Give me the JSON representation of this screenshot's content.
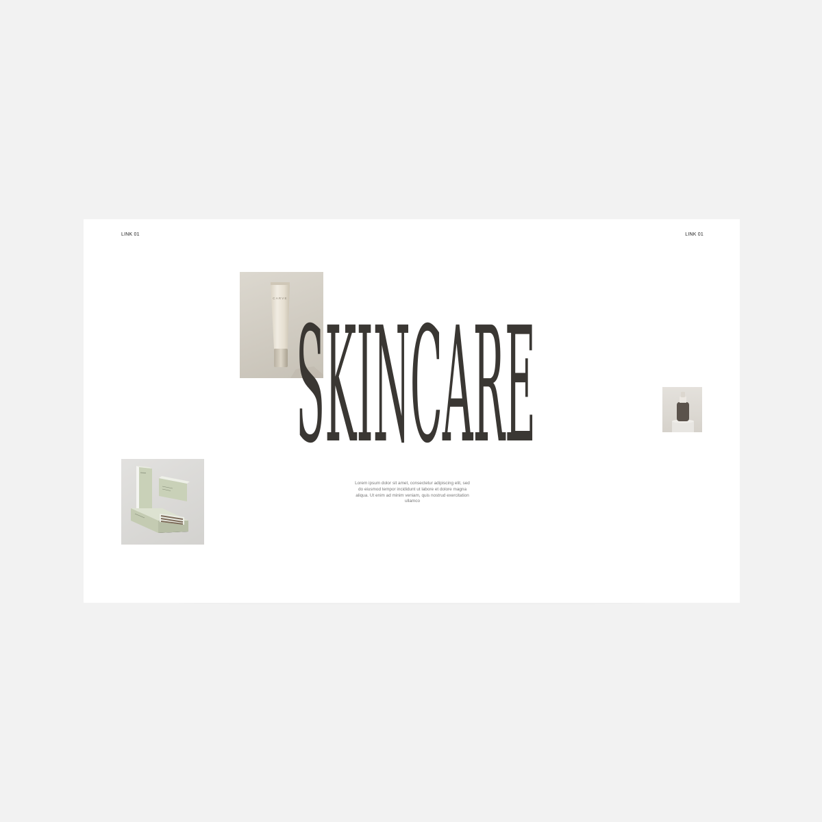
{
  "header": {
    "left_link": "LINK 01",
    "right_link": "LINK 01"
  },
  "hero": {
    "title": "SKINCARE",
    "description": "Lorem ipsum dolor sit amet, consectetur adipiscing elit, sed do eiusmod tempor incididunt ut labore et dolore magna aliqua. Ut enim ad minim veniam, quis nostrud exercitation ullamco"
  },
  "images": {
    "tube_brand": "CARVE"
  },
  "colors": {
    "page_background": "#f2f2f2",
    "frame_background": "#ffffff",
    "headline": "#3a3733",
    "body_text": "#777777",
    "sage_accent": "#c9d1b8"
  }
}
